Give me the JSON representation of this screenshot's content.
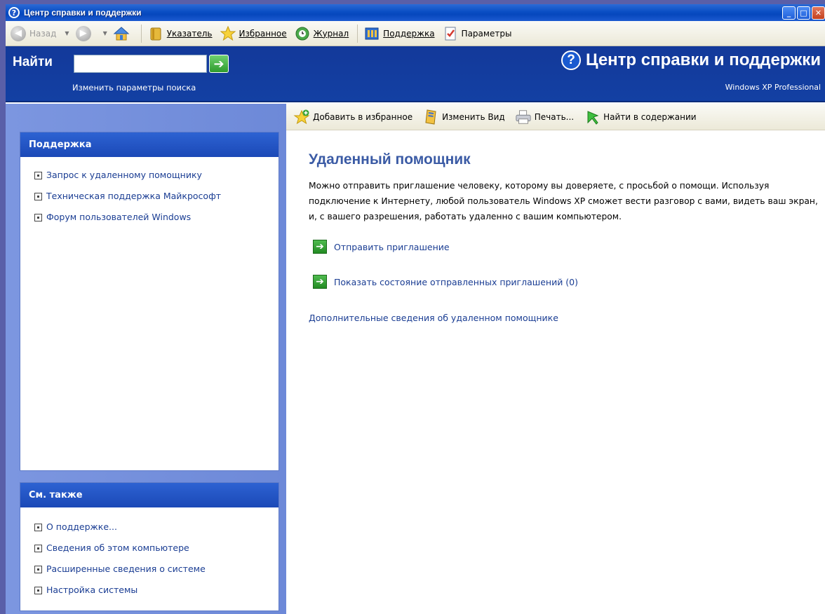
{
  "window": {
    "title": "Центр справки и поддержки",
    "controls": {
      "minimize": "_",
      "maximize": "□",
      "close": "✕"
    }
  },
  "toolbar": {
    "back_label": "Назад",
    "index_label": "Указатель",
    "favorites_label": "Избранное",
    "history_label": "Журнал",
    "support_label": "Поддержка",
    "options_label": "Параметры"
  },
  "search": {
    "label": "Найти",
    "value": "",
    "go_symbol": "➔",
    "options_link": "Изменить параметры поиска"
  },
  "header": {
    "title": "Центр справки и поддержки",
    "edition": "Windows XP Professional"
  },
  "support_panel": {
    "title": "Поддержка",
    "items": [
      "Запрос к удаленному помощнику",
      "Техническая поддержка Майкрософт",
      "Форум пользователей Windows"
    ]
  },
  "see_also_panel": {
    "title": "См. также",
    "items": [
      "О поддержке...",
      "Сведения об этом компьютере",
      "Расширенные сведения о системе",
      "Настройка системы"
    ]
  },
  "content_toolbar": {
    "add_favorites": "Добавить в избранное",
    "change_view": "Изменить Вид",
    "print": "Печать...",
    "find_in_contents": "Найти в содержании"
  },
  "content": {
    "heading": "Удаленный помощник",
    "description": "Можно отправить приглашение человеку, которому вы доверяете, с просьбой о помощи. Используя подключение к Интернету, любой пользователь Windows XP сможет вести разговор с вами, видеть ваш экран, и, с вашего разрешения, работать удаленно с вашим компьютером.",
    "send_invitation": "Отправить приглашение",
    "show_status": "Показать состояние отправленных приглашений (0)",
    "more_info": "Дополнительные сведения об удаленном помощнике"
  }
}
